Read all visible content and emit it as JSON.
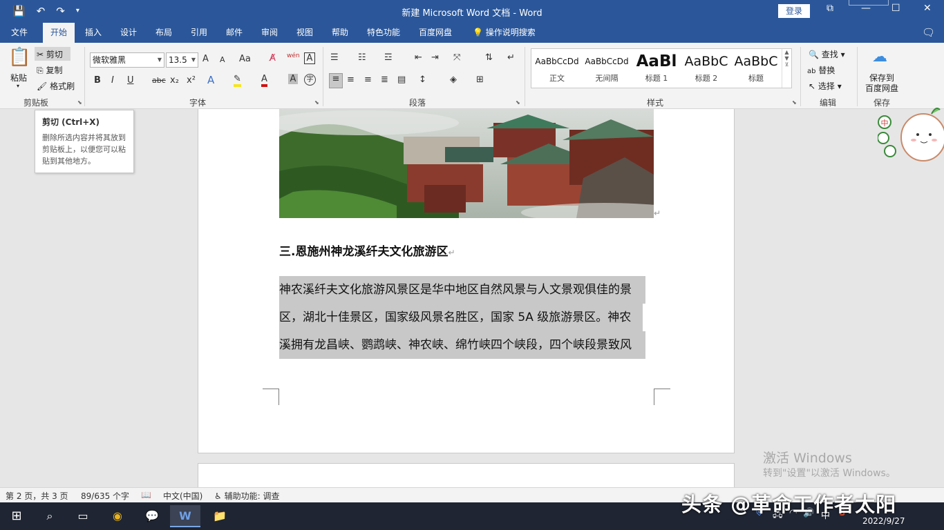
{
  "window": {
    "title": "新建 Microsoft Word 文档  -  Word",
    "login_label": "登录",
    "controls": {
      "restore_ribbon": "⧉",
      "minimize": "—",
      "maximize": "☐",
      "close": "✕"
    }
  },
  "qat": {
    "save_icon": "save-icon",
    "undo_icon": "undo-icon",
    "redo_icon": "redo-icon",
    "customize_icon": "customize-qat-icon"
  },
  "menu": {
    "tabs": [
      "文件",
      "开始",
      "插入",
      "设计",
      "布局",
      "引用",
      "邮件",
      "审阅",
      "视图",
      "帮助",
      "特色功能",
      "百度网盘"
    ],
    "active": "开始",
    "search_label": "操作说明搜索",
    "share_icon": "comment-icon"
  },
  "ribbon": {
    "clipboard": {
      "paste": "粘贴",
      "cut": "剪切",
      "copy": "复制",
      "format_painter": "格式刷",
      "label": "剪贴板"
    },
    "font": {
      "font_name": "微软雅黑",
      "font_size": "13.5",
      "label": "字体",
      "buttons": {
        "bold": "B",
        "italic": "I",
        "underline": "U",
        "strike": "abc",
        "subscript": "x₂",
        "superscript": "x²",
        "grow": "A",
        "shrink": "A",
        "case": "Aa",
        "phonetic": "wén",
        "border_char": "A"
      }
    },
    "paragraph": {
      "label": "段落"
    },
    "styles": {
      "label": "样式",
      "items": [
        {
          "preview": "AaBbCcDd",
          "name": "正文"
        },
        {
          "preview": "AaBbCcDd",
          "name": "无间隔"
        },
        {
          "preview": "AaBl",
          "name": "标题 1"
        },
        {
          "preview": "AaBbC",
          "name": "标题 2"
        },
        {
          "preview": "AaBbC",
          "name": "标题"
        }
      ]
    },
    "editing": {
      "find": "查找",
      "replace": "替换",
      "select": "选择",
      "label": "编辑"
    },
    "save": {
      "save_to": "保存到",
      "baidu": "百度网盘",
      "label": "保存"
    }
  },
  "tooltip": {
    "title": "剪切 (Ctrl+X)",
    "body": "删除所选内容并将其放到剪贴板上，以便您可以粘贴到其他地方。"
  },
  "document": {
    "heading": "三.恩施州神龙溪纤夫文化旅游区",
    "lines": [
      "神农溪纤夫文化旅游风景区是华中地区自然风景与人文景观俱佳的景",
      "区，湖北十佳景区，国家级风景名胜区，国家 5A 级旅游景区。神农",
      "溪拥有龙昌峡、鹦鹉峡、神农峡、绵竹峡四个峡段，四个峡段景致风"
    ],
    "para_mark": "↵"
  },
  "watermark": {
    "line1": "激活 Windows",
    "line2": "转到\"设置\"以激活 Windows。"
  },
  "status": {
    "page": "第 2 页，共 3 页",
    "words": "89/635 个字",
    "language": "中文(中国)",
    "accessibility": "辅助功能: 调查"
  },
  "taskbar": {
    "overlay": "头条 @革命工作者太阳",
    "date": "2022/9/27",
    "ime": "中"
  },
  "colors": {
    "accent": "#2b579a",
    "highlight": "#c8c8c8",
    "taskbar": "#1f2532"
  }
}
